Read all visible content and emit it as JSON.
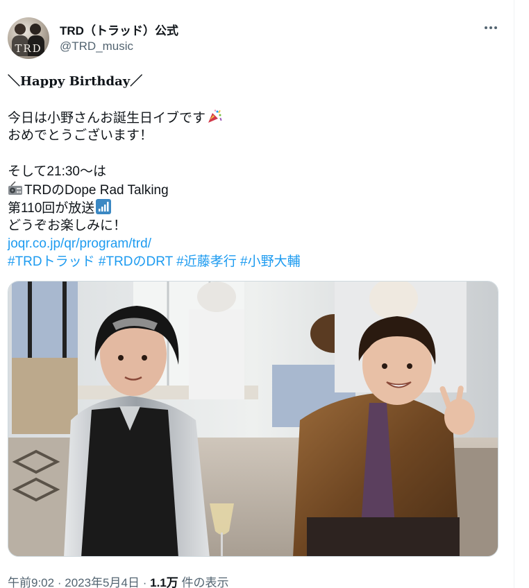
{
  "tweet": {
    "display_name": "TRD（トラッド）公式",
    "handle": "@TRD_music",
    "avatar_text": "TRD",
    "lines": {
      "greeting": "＼Happy Birthday／",
      "l1": "今日は小野さんお誕生日イブです",
      "l2": "おめでとうございます！",
      "l3": "そして21:30～は",
      "l4": "TRDのDope Rad Talking",
      "l5": "第110回が放送",
      "l6": "どうぞお楽しみに！"
    },
    "link": "joqr.co.jp/qr/program/trd/",
    "hashtags": [
      "#TRDトラッド",
      "#TRDのDRT",
      "#近藤孝行",
      "#小野大輔"
    ],
    "meta": {
      "time": "午前9:02",
      "sep": "·",
      "date": "2023年5月4日",
      "views_count": "1.1万",
      "views_label": "件の表示"
    },
    "icons": {
      "more": "more-horizontal-icon",
      "party": "party-popper-icon",
      "radio": "radio-icon",
      "signal": "antenna-bars-icon"
    },
    "colors": {
      "link": "#1d9bf0",
      "text": "#0f1419",
      "secondary": "#536471"
    }
  }
}
